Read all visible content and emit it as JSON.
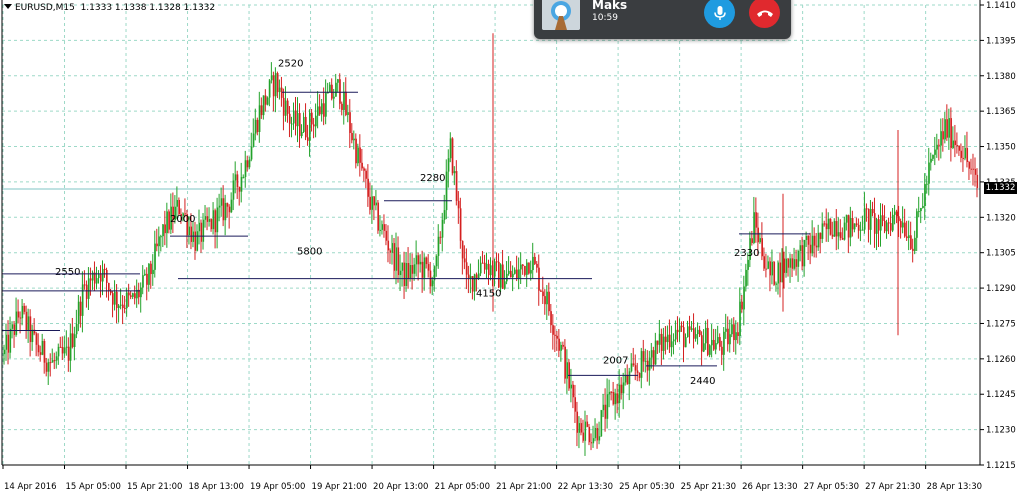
{
  "header": {
    "symbol": "EURUSD,M15",
    "ohlc": "1.1333 1.1338 1.1328 1.1332"
  },
  "call": {
    "name": "Maks",
    "time": "10:59"
  },
  "current_price": "1.1332",
  "colors": {
    "bull": "#22a22a",
    "bear": "#d42020",
    "grid": "#9dd9c8",
    "accent_mic": "#1f9be0",
    "accent_hang": "#e0292e"
  },
  "chart_data": {
    "type": "candlestick",
    "y_ticks": [
      "1.1410",
      "1.1395",
      "1.1380",
      "1.1365",
      "1.1350",
      "1.1335",
      "1.1320",
      "1.1305",
      "1.1290",
      "1.1275",
      "1.1260",
      "1.1245",
      "1.1230",
      "1.1215"
    ],
    "ylim": [
      1.1212,
      1.1412
    ],
    "x_ticks": [
      "14 Apr 2016",
      "15 Apr 05:00",
      "15 Apr 21:00",
      "18 Apr 13:00",
      "19 Apr 05:00",
      "19 Apr 21:00",
      "20 Apr 13:00",
      "21 Apr 05:00",
      "21 Apr 21:00",
      "22 Apr 13:30",
      "25 Apr 05:30",
      "25 Apr 21:30",
      "26 Apr 13:30",
      "27 Apr 05:30",
      "27 Apr 21:30",
      "28 Apr 13:30"
    ],
    "price_path": [
      [
        0,
        1.1262
      ],
      [
        1,
        1.128
      ],
      [
        2,
        1.1265
      ],
      [
        3,
        1.1258
      ],
      [
        4,
        1.1262
      ],
      [
        5,
        1.129
      ],
      [
        6,
        1.1298
      ],
      [
        7,
        1.1285
      ],
      [
        8,
        1.1284
      ],
      [
        9,
        1.1293
      ],
      [
        10,
        1.1315
      ],
      [
        11,
        1.1325
      ],
      [
        12,
        1.131
      ],
      [
        13,
        1.1318
      ],
      [
        14,
        1.1325
      ],
      [
        15,
        1.134
      ],
      [
        16,
        1.1365
      ],
      [
        17,
        1.1378
      ],
      [
        18,
        1.136
      ],
      [
        19,
        1.1358
      ],
      [
        20,
        1.1368
      ],
      [
        21,
        1.1375
      ],
      [
        22,
        1.135
      ],
      [
        23,
        1.1325
      ],
      [
        24,
        1.131
      ],
      [
        25,
        1.1295
      ],
      [
        26,
        1.13
      ],
      [
        27,
        1.1294
      ],
      [
        28,
        1.135
      ],
      [
        29,
        1.129
      ],
      [
        30,
        1.1302
      ],
      [
        31,
        1.1295
      ],
      [
        32,
        1.1295
      ],
      [
        33,
        1.1303
      ],
      [
        34,
        1.1285
      ],
      [
        35,
        1.1262
      ],
      [
        36,
        1.1232
      ],
      [
        37,
        1.1228
      ],
      [
        38,
        1.1242
      ],
      [
        39,
        1.125
      ],
      [
        40,
        1.1258
      ],
      [
        41,
        1.1265
      ],
      [
        42,
        1.1272
      ],
      [
        43,
        1.1268
      ],
      [
        44,
        1.1268
      ],
      [
        45,
        1.1265
      ],
      [
        46,
        1.1275
      ],
      [
        47,
        1.1318
      ],
      [
        48,
        1.1295
      ],
      [
        49,
        1.13
      ],
      [
        50,
        1.1305
      ],
      [
        51,
        1.131
      ],
      [
        52,
        1.1318
      ],
      [
        53,
        1.1315
      ],
      [
        54,
        1.132
      ],
      [
        55,
        1.1315
      ],
      [
        56,
        1.1322
      ],
      [
        57,
        1.131
      ],
      [
        58,
        1.134
      ],
      [
        59,
        1.1358
      ],
      [
        60,
        1.135
      ],
      [
        61,
        1.1332
      ]
    ],
    "levels": [
      {
        "label": "2550",
        "price": 1.12888
      },
      {
        "label": "2000",
        "price": 1.1312
      },
      {
        "label": "2520",
        "price": 1.1373
      },
      {
        "label": "2280",
        "price": 1.1327
      },
      {
        "label": "5800",
        "price": 1.1294
      },
      {
        "label": "4150",
        "price": 1.1294
      },
      {
        "label": "2007",
        "price": 1.1253
      },
      {
        "label": "2440",
        "price": 1.1257
      },
      {
        "label": "2330",
        "price": 1.1313
      }
    ]
  }
}
